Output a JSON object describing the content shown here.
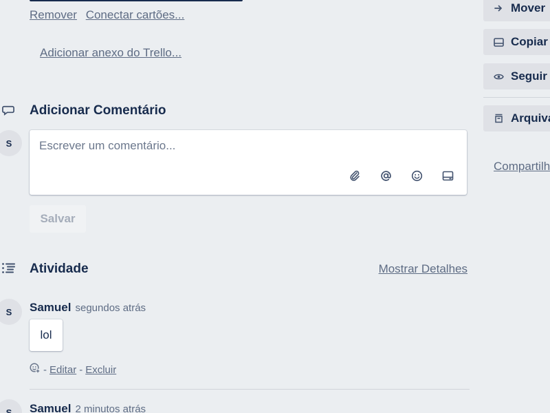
{
  "attachments": {
    "remove_label": "Remover",
    "connect_cards_label": "Conectar cartões...",
    "trello_attach_label": "Adicionar anexo do Trello..."
  },
  "add_comment": {
    "title": "Adicionar Comentário",
    "avatar_initial": "S",
    "placeholder": "Escrever um comentário...",
    "save_label": "Salvar",
    "tool_icons": [
      "paperclip-icon",
      "mention-icon",
      "emoji-icon",
      "card-icon"
    ]
  },
  "activity": {
    "title": "Atividade",
    "show_details_label": "Mostrar Detalhes",
    "items": [
      {
        "avatar_initial": "S",
        "author": "Samuel",
        "time": "segundos atrás",
        "comment": "lol",
        "edit_label": "Editar",
        "delete_label": "Excluir",
        "separator": "-"
      },
      {
        "avatar_initial": "S",
        "author": "Samuel",
        "time": "2 minutos atrás"
      }
    ]
  },
  "sidebar": {
    "buttons": [
      {
        "label": "Mover",
        "icon": "arrow-right-icon"
      },
      {
        "label": "Copiar",
        "icon": "copy-icon"
      },
      {
        "label": "Seguir",
        "icon": "eye-icon"
      },
      {
        "label": "Arquivar",
        "icon": "archive-icon"
      }
    ],
    "share_label": "Compartilhar"
  },
  "colors": {
    "background": "#ebeef1",
    "text": "#172b4d",
    "muted": "#5e6c84",
    "button": "#dfe1e6"
  }
}
